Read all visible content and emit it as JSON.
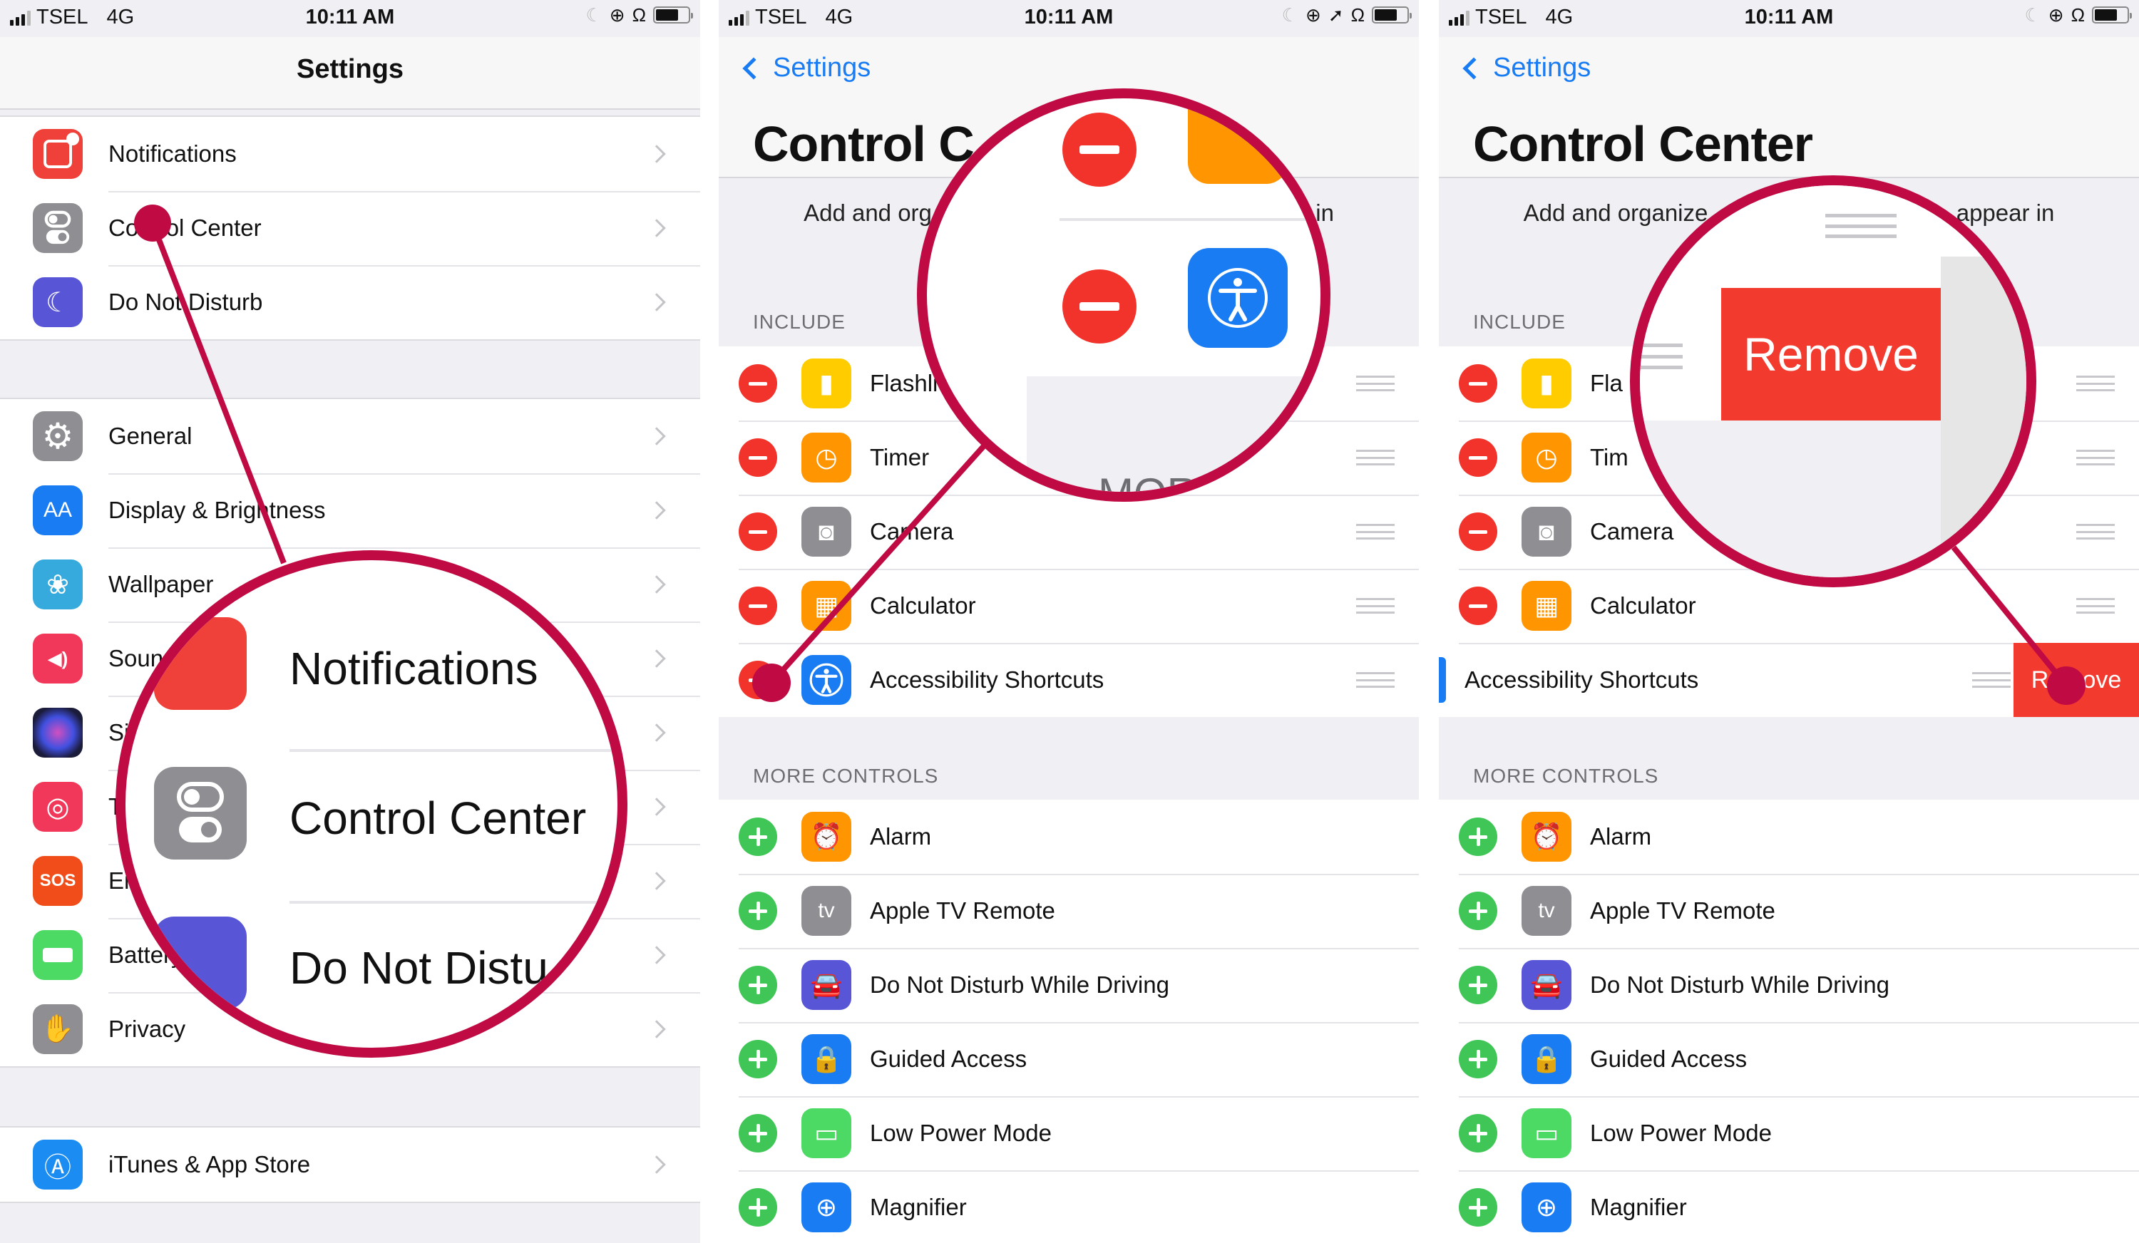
{
  "status_bar": {
    "carrier": "TSEL",
    "network": "4G",
    "time": "10:11 AM",
    "icons": [
      "moon-icon",
      "rotation-lock-icon",
      "headphones-icon",
      "battery-icon"
    ],
    "icons_with_location": [
      "moon-icon",
      "rotation-lock-icon",
      "location-arrow-icon",
      "headphones-icon",
      "battery-icon"
    ]
  },
  "panel1": {
    "title": "Settings",
    "groups": [
      [
        {
          "label": "Notifications",
          "icon": "notifications-icon",
          "color": "#f0403a"
        },
        {
          "label": "Control Center",
          "icon": "control-center-icon",
          "color": "#8e8e93"
        },
        {
          "label": "Do Not Disturb",
          "icon": "moon-icon",
          "color": "#5856d6"
        }
      ],
      [
        {
          "label": "General",
          "icon": "gear-icon",
          "color": "#8e8e93"
        },
        {
          "label": "Display & Brightness",
          "icon": "text-size-icon",
          "color": "#1a7cf2"
        },
        {
          "label": "Wallpaper",
          "icon": "flower-icon",
          "color": "#36aadc"
        },
        {
          "label": "Sounds",
          "icon": "speaker-icon",
          "color": "#f2385a"
        },
        {
          "label": "Siri",
          "icon": "siri-icon",
          "color": "#1b1b3a"
        },
        {
          "label": "Touch ID & Passcode",
          "icon": "fingerprint-icon",
          "color": "#f2385a"
        },
        {
          "label": "Emergency SOS",
          "icon": "sos-icon",
          "color": "#f04d1a"
        },
        {
          "label": "Battery",
          "icon": "battery-icon",
          "color": "#4cd964"
        },
        {
          "label": "Privacy",
          "icon": "hand-icon",
          "color": "#8e8e93"
        }
      ],
      [
        {
          "label": "iTunes & App Store",
          "icon": "app-store-icon",
          "color": "#1a8cf2"
        }
      ]
    ],
    "magnifier": {
      "rows": [
        "Notifications",
        "Control Center",
        "Do Not Distu"
      ]
    }
  },
  "control_center": {
    "back_label": "Settings",
    "title": "Control Center",
    "title_clipped": "Control C",
    "description_left": "Add and org",
    "description_right": "in",
    "description_left_p3": "Add and organize",
    "description_right_p3": "appear in",
    "include_header": "INCLUDE",
    "more_header": "MORE CONTROLS",
    "include": [
      {
        "label": "Flashlight",
        "label_p2": "Flashli",
        "label_p3": "Fla",
        "icon": "flashlight-icon",
        "color": "#ffcc00"
      },
      {
        "label": "Timer",
        "label_p2": "Timer",
        "label_p3": "Tim",
        "icon": "timer-icon",
        "color": "#ff9500"
      },
      {
        "label": "Camera",
        "label_p2": "Camera",
        "label_p3": "Camera",
        "icon": "camera-icon",
        "color": "#8e8e93"
      },
      {
        "label": "Calculator",
        "label_p2": "Calculator",
        "label_p3": "Calculator",
        "icon": "calculator-icon",
        "color": "#ff9500"
      },
      {
        "label": "Accessibility Shortcuts",
        "label_p2": "Accessibility Shortcuts",
        "label_p3": "Accessibility Shortcuts",
        "icon": "accessibility-icon",
        "color": "#1a7cf2"
      }
    ],
    "more": [
      {
        "label": "Alarm",
        "icon": "alarm-icon",
        "color": "#ff9500"
      },
      {
        "label": "Apple TV Remote",
        "icon": "apple-tv-icon",
        "color": "#8e8e93"
      },
      {
        "label": "Do Not Disturb While Driving",
        "icon": "car-icon",
        "color": "#5856d6"
      },
      {
        "label": "Guided Access",
        "icon": "lock-icon",
        "color": "#1a7cf2"
      },
      {
        "label": "Low Power Mode",
        "icon": "low-battery-icon",
        "color": "#4cd964"
      },
      {
        "label": "Magnifier",
        "icon": "magnifier-icon",
        "color": "#1a7cf2"
      }
    ],
    "remove_label": "Remove",
    "magnifier_p2_text": "MORE",
    "magnifier_p3_remove": "Remove"
  },
  "colors": {
    "accent": "#1a7cf2",
    "annotation": "#bf0a43",
    "destructive": "#f33a2e",
    "add": "#3fc657"
  }
}
